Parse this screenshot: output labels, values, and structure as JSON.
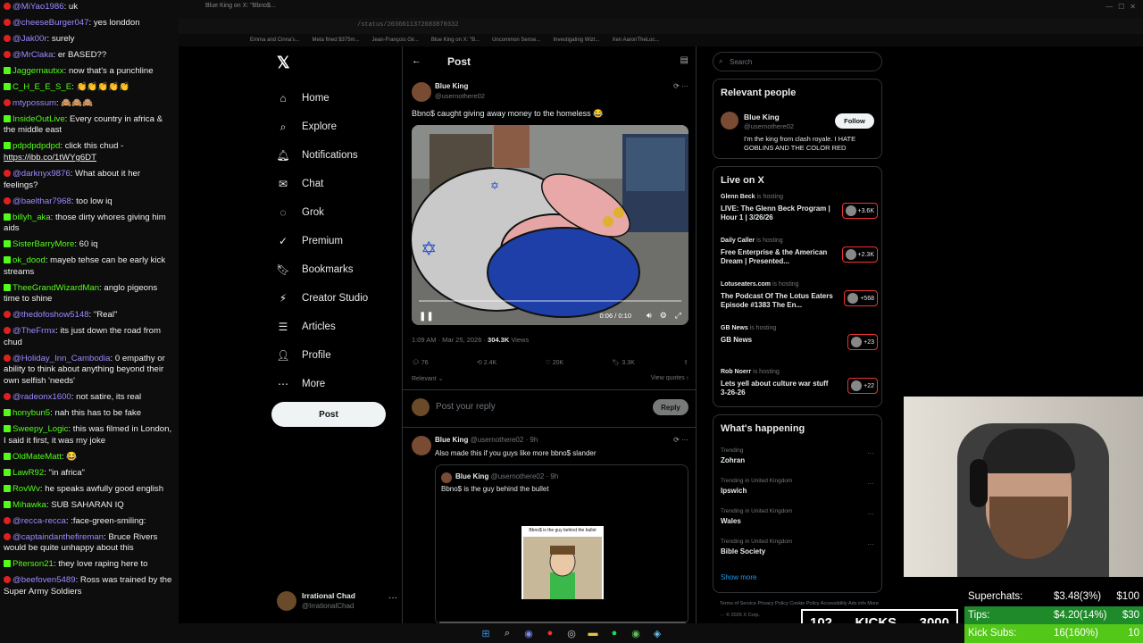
{
  "browser": {
    "tab_title": "Blue King on X: \"Bbno$...",
    "address": "/status/2036611372683870332",
    "bookmarks": [
      "Emma and Cinna's...",
      "Meta fined $375m...",
      "Jean-François Gir...",
      "Blue King on X: \"B...",
      "Uncommon Sense...",
      "Investigating Wizt...",
      "Xen AaronTheLoc..."
    ]
  },
  "chat": [
    {
      "src": "yt",
      "name": "@MiYao1986",
      "msg": "uk"
    },
    {
      "src": "yt",
      "name": "@cheeseBurger047",
      "msg": "yes londdon"
    },
    {
      "src": "yt",
      "name": "@Jak00r",
      "msg": "surely"
    },
    {
      "src": "yt",
      "name": "@MrClaka",
      "msg": "er BASED??"
    },
    {
      "src": "k",
      "name": "Jaggernautxx",
      "msg": "now that's a punchline"
    },
    {
      "src": "k",
      "name": "C_H_E_E_S_E",
      "msg": "👏👏👏👏👏"
    },
    {
      "src": "yt",
      "name": "mtypossum",
      "msg": "🙈🙈🙈"
    },
    {
      "src": "k",
      "name": "InsideOutLive",
      "msg": "Every country in africa & the middle east"
    },
    {
      "src": "k",
      "name": "pdpdpdpdpd",
      "msg": "click this chud -",
      "link": "https://ibb.co/1tWYg6DT"
    },
    {
      "src": "yt",
      "name": "@darknyx9876",
      "msg": "What about it her feelings?"
    },
    {
      "src": "yt",
      "name": "@baelthar7968",
      "msg": "too low iq"
    },
    {
      "src": "k",
      "name": "billyh_aka",
      "msg": "those dirty whores giving him aids"
    },
    {
      "src": "k",
      "name": "SisterBarryMore",
      "msg": "60 iq"
    },
    {
      "src": "k",
      "name": "ok_dood",
      "msg": "mayeb tehse can be early kick streams"
    },
    {
      "src": "k",
      "name": "TheeGrandWizardMan",
      "msg": "anglo pigeons time to shine"
    },
    {
      "src": "yt",
      "name": "@thedofoshow5148",
      "msg": "\"Real\""
    },
    {
      "src": "yt",
      "name": "@TheFrmx",
      "msg": "its just down the road from chud"
    },
    {
      "src": "yt",
      "name": "@Holiday_Inn_Cambodia",
      "msg": "0 empathy or ability to think about anything beyond their own selfish 'needs'"
    },
    {
      "src": "yt",
      "name": "@radeonx1600",
      "msg": "not satire, its real"
    },
    {
      "src": "k",
      "name": "honybun5",
      "msg": "nah this has to be fake"
    },
    {
      "src": "k",
      "name": "Sweepy_Logic",
      "msg": "this was filmed in London, I said it first, it was my joke"
    },
    {
      "src": "k",
      "name": "OldMateMatt",
      "msg": "😂"
    },
    {
      "src": "k",
      "name": "LawR92",
      "msg": "\"in africa\""
    },
    {
      "src": "k",
      "name": "RovWv",
      "msg": "he speaks awfully good english"
    },
    {
      "src": "k",
      "name": "Mihawka",
      "msg": "SUB SAHARAN IQ"
    },
    {
      "src": "yt",
      "name": "@recca-recca",
      "msg": ":face-green-smiling:"
    },
    {
      "src": "yt",
      "name": "@captaindanthefireman",
      "msg": "Bruce Rivers would be quite unhappy about this"
    },
    {
      "src": "k",
      "name": "Piterson21",
      "msg": "they love raping here to"
    },
    {
      "src": "yt",
      "name": "@beefoven5489",
      "msg": "Ross was trained by the Super Army Soldiers"
    }
  ],
  "nav": {
    "logo": "𝕏",
    "items": [
      {
        "icon": "⌂",
        "label": "Home"
      },
      {
        "icon": "⌕",
        "label": "Explore"
      },
      {
        "icon": "🔔︎",
        "label": "Notifications"
      },
      {
        "icon": "✉︎",
        "label": "Chat"
      },
      {
        "icon": "◌",
        "label": "Grok"
      },
      {
        "icon": "✓",
        "label": "Premium"
      },
      {
        "icon": "🔖︎",
        "label": "Bookmarks"
      },
      {
        "icon": "⚡︎",
        "label": "Creator Studio"
      },
      {
        "icon": "☰",
        "label": "Articles"
      },
      {
        "icon": "👤︎",
        "label": "Profile"
      },
      {
        "icon": "⋯",
        "label": "More"
      }
    ],
    "post_label": "Post",
    "account": {
      "name": "Irrational Chad",
      "handle": "@IrrationalChad",
      "menu": "···"
    }
  },
  "post": {
    "header_title": "Post",
    "author_name": "Blue King",
    "author_handle": "@usernothere02",
    "text": "Bbno$ caught giving away money to the homeless 😂",
    "video_time": "0:06 / 0:10",
    "timestamp": "1:09 AM · Mar 25, 2026 · ",
    "views": "304.3K",
    "views_label": " Views",
    "replies": "76",
    "reposts": "2.4K",
    "likes": "20K",
    "bookmarks": "3.3K",
    "relevant": "Relevant ⌄",
    "view_quotes": "View quotes ›",
    "reply_placeholder": "Post your reply",
    "reply_button": "Reply"
  },
  "reply1": {
    "author_name": "Blue King",
    "author_meta": "@usernothere02 · 9h",
    "text": "Also made this if you guys like more bbno$ slander",
    "quote_name": "Blue King",
    "quote_meta": "@usernothere02 · 9h",
    "quote_text": "Bbno$ is the guy behind the bullet",
    "quote_image_caption": "Bbno$ is the guy behind the bullet"
  },
  "search": {
    "placeholder": "Search"
  },
  "relevant_people": {
    "title": "Relevant people",
    "name": "Blue King",
    "handle": "@usernothere02",
    "bio": "I'm the king from clash royale. I HATE GOBLINS AND THE COLOR RED",
    "follow": "Follow"
  },
  "live": {
    "title": "Live on X",
    "hosting": " is hosting",
    "items": [
      {
        "host": "Glenn Beck",
        "title": "LIVE: The Glenn Beck Program | Hour 1 | 3/26/26",
        "count": "+3.6K"
      },
      {
        "host": "Daily Caller",
        "title": "Free Enterprise & the American Dream | Presented...",
        "count": "+2.3K"
      },
      {
        "host": "Lotuseaters.com",
        "title": "The Podcast Of The Lotus Eaters Episode #1383 The En...",
        "count": "+568"
      },
      {
        "host": "GB News",
        "title": "GB News",
        "count": "+23"
      },
      {
        "host": "Rob Noerr",
        "title": "Lets yell about culture war stuff 3-26-26",
        "count": "+22"
      }
    ]
  },
  "happening": {
    "title": "What's happening",
    "items": [
      {
        "context": "Trending",
        "name": "Zohran"
      },
      {
        "context": "Trending in United Kingdom",
        "name": "Ipswich"
      },
      {
        "context": "Trending in United Kingdom",
        "name": "Wales"
      },
      {
        "context": "Trending in United Kingdom",
        "name": "Bible Society"
      }
    ],
    "show_more": "Show more"
  },
  "footer": "Terms of Service   Privacy Policy   Cookie Policy   Accessibility   Ads info   More ···   © 2026 X Corp.",
  "kicks": {
    "count": "102",
    "label": "KICKS",
    "goal": "3000"
  },
  "donations": [
    {
      "label": "Superchats:",
      "value": "$3.48(3%)",
      "goal": "$100",
      "bg": "#1f8a2a"
    },
    {
      "label": "Tips:",
      "value": "$4.20(14%)",
      "goal": "$30",
      "bg": "#1f8a2a"
    },
    {
      "label": "Kick Subs:",
      "value": "16(160%)",
      "goal": "10",
      "bg": "#53c818"
    }
  ],
  "colors": {
    "accent": "#1d9bf0",
    "kick_green": "#53fc18",
    "youtube_red": "#e02020"
  }
}
